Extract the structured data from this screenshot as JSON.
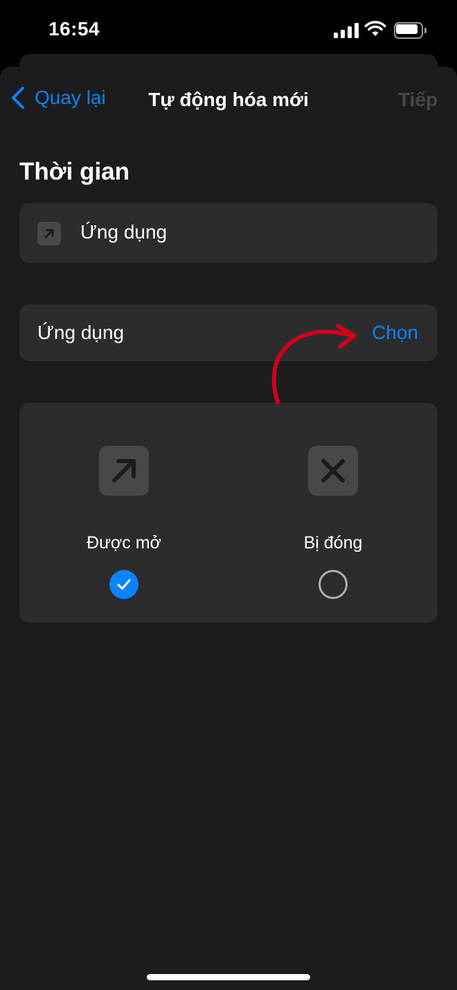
{
  "status_bar": {
    "time": "16:54",
    "signal_icon": "cellular-signal-icon",
    "wifi_icon": "wifi-icon",
    "battery_icon": "battery-icon",
    "battery_level": 0.85
  },
  "nav": {
    "back_label": "Quay lại",
    "title": "Tự động hóa mới",
    "next_label": "Tiếp",
    "accent_color": "#0a84ff",
    "disabled_color": "#474749"
  },
  "section": {
    "title": "Thời gian"
  },
  "trigger": {
    "icon": "app-arrow-icon",
    "label": "Ứng dụng"
  },
  "app_picker": {
    "label": "Ứng dụng",
    "action_label": "Chọn"
  },
  "state_options": [
    {
      "icon": "arrow-up-right-icon",
      "label": "Được mở",
      "checked": true
    },
    {
      "icon": "xmark-icon",
      "label": "Bị đóng",
      "checked": false
    }
  ],
  "annotation": {
    "arrow_color": "#d0021b"
  }
}
